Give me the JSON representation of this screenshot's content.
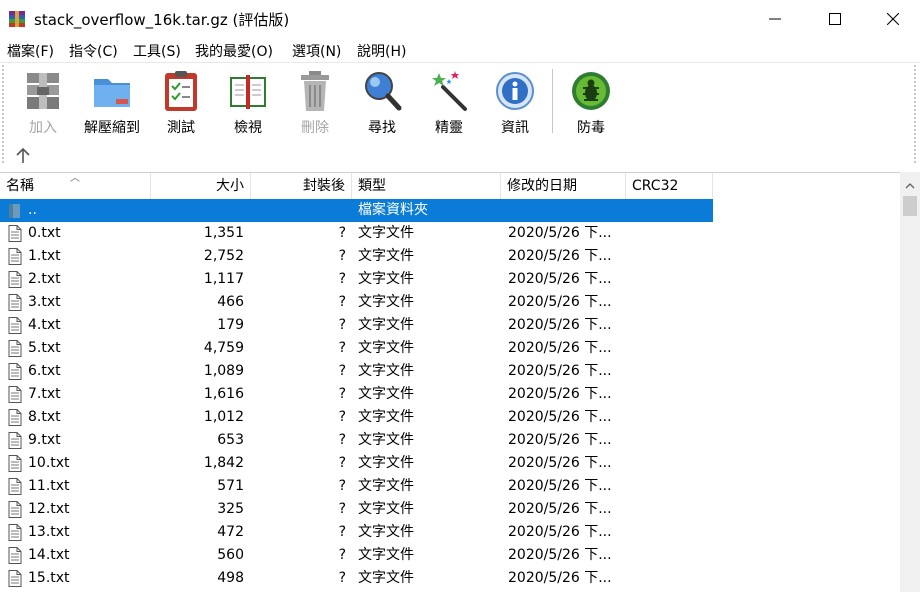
{
  "window": {
    "title": "stack_overflow_16k.tar.gz (評估版)"
  },
  "menu": [
    {
      "label": "檔案(F)"
    },
    {
      "label": "指令(C)"
    },
    {
      "label": "工具(S)"
    },
    {
      "label": "我的最愛(O)"
    },
    {
      "label": "選項(N)"
    },
    {
      "label": "說明(H)"
    }
  ],
  "toolbar": {
    "tools": [
      {
        "label": "加入",
        "icon": "add-archive-icon",
        "enabled": false
      },
      {
        "label": "解壓縮到",
        "icon": "extract-folder-icon",
        "enabled": true
      },
      {
        "label": "測試",
        "icon": "test-clipboard-icon",
        "enabled": true
      },
      {
        "label": "檢視",
        "icon": "view-book-icon",
        "enabled": true
      },
      {
        "label": "刪除",
        "icon": "trash-icon",
        "enabled": false
      },
      {
        "label": "尋找",
        "icon": "magnifier-icon",
        "enabled": true
      },
      {
        "label": "精靈",
        "icon": "wizard-wand-icon",
        "enabled": true
      },
      {
        "label": "資訊",
        "icon": "info-icon",
        "enabled": true
      },
      {
        "label": "防毒",
        "icon": "antivirus-bug-icon",
        "enabled": true
      }
    ]
  },
  "columns": {
    "name": "名稱",
    "size": "大小",
    "packed": "封裝後",
    "type": "類型",
    "modified": "修改的日期",
    "crc": "CRC32"
  },
  "parent_row": {
    "name": "..",
    "type": "檔案資料夾"
  },
  "files": [
    {
      "name": "0.txt",
      "size": "1,351",
      "packed": "?",
      "type": "文字文件",
      "modified": "2020/5/26 下..."
    },
    {
      "name": "1.txt",
      "size": "2,752",
      "packed": "?",
      "type": "文字文件",
      "modified": "2020/5/26 下..."
    },
    {
      "name": "2.txt",
      "size": "1,117",
      "packed": "?",
      "type": "文字文件",
      "modified": "2020/5/26 下..."
    },
    {
      "name": "3.txt",
      "size": "466",
      "packed": "?",
      "type": "文字文件",
      "modified": "2020/5/26 下..."
    },
    {
      "name": "4.txt",
      "size": "179",
      "packed": "?",
      "type": "文字文件",
      "modified": "2020/5/26 下..."
    },
    {
      "name": "5.txt",
      "size": "4,759",
      "packed": "?",
      "type": "文字文件",
      "modified": "2020/5/26 下..."
    },
    {
      "name": "6.txt",
      "size": "1,089",
      "packed": "?",
      "type": "文字文件",
      "modified": "2020/5/26 下..."
    },
    {
      "name": "7.txt",
      "size": "1,616",
      "packed": "?",
      "type": "文字文件",
      "modified": "2020/5/26 下..."
    },
    {
      "name": "8.txt",
      "size": "1,012",
      "packed": "?",
      "type": "文字文件",
      "modified": "2020/5/26 下..."
    },
    {
      "name": "9.txt",
      "size": "653",
      "packed": "?",
      "type": "文字文件",
      "modified": "2020/5/26 下..."
    },
    {
      "name": "10.txt",
      "size": "1,842",
      "packed": "?",
      "type": "文字文件",
      "modified": "2020/5/26 下..."
    },
    {
      "name": "11.txt",
      "size": "571",
      "packed": "?",
      "type": "文字文件",
      "modified": "2020/5/26 下..."
    },
    {
      "name": "12.txt",
      "size": "325",
      "packed": "?",
      "type": "文字文件",
      "modified": "2020/5/26 下..."
    },
    {
      "name": "13.txt",
      "size": "472",
      "packed": "?",
      "type": "文字文件",
      "modified": "2020/5/26 下..."
    },
    {
      "name": "14.txt",
      "size": "560",
      "packed": "?",
      "type": "文字文件",
      "modified": "2020/5/26 下..."
    },
    {
      "name": "15.txt",
      "size": "498",
      "packed": "?",
      "type": "文字文件",
      "modified": "2020/5/26 下..."
    }
  ],
  "colors": {
    "selection": "#0a7bd6"
  }
}
